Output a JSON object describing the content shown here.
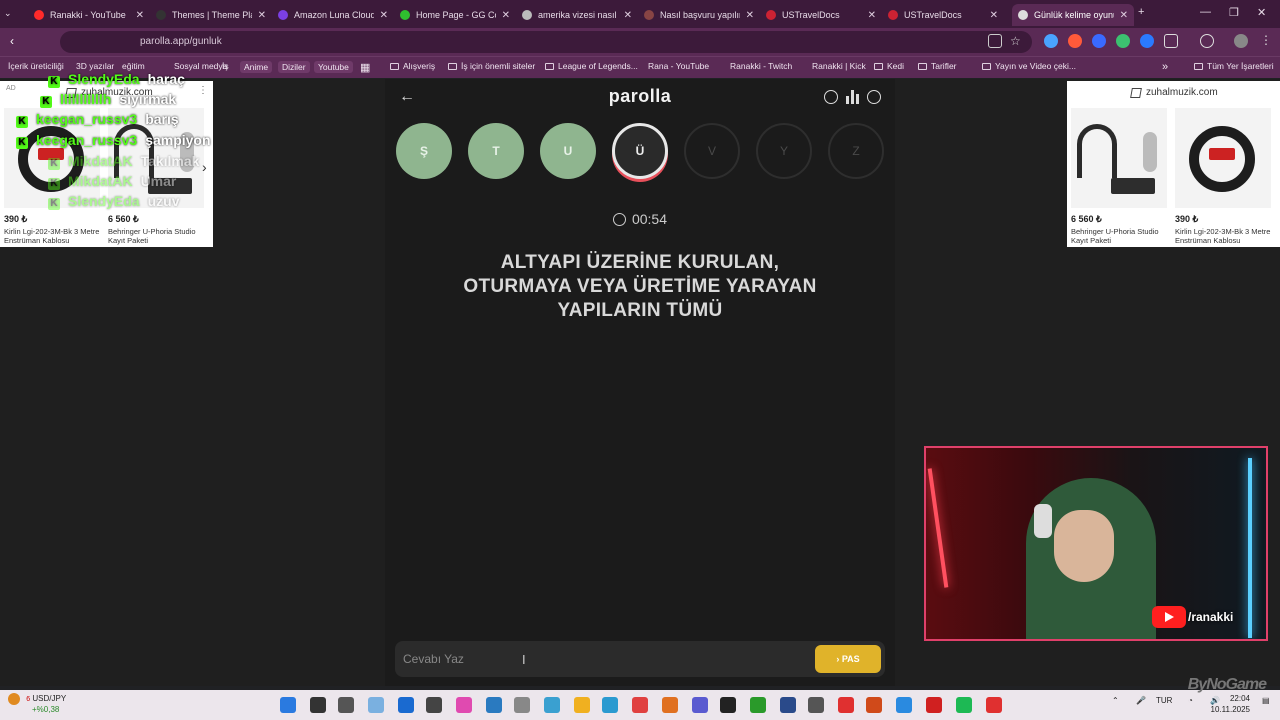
{
  "browser": {
    "tabs": [
      {
        "label": "Ranakki - YouTube",
        "color": "#ff2a2a"
      },
      {
        "label": "Themes | Theme Plaza",
        "color": "#333333"
      },
      {
        "label": "Amazon Luna Cloud",
        "color": "#7b3fe4"
      },
      {
        "label": "Home Page - GG Con",
        "color": "#2fbf2f"
      },
      {
        "label": "amerika vizesi nasıl al",
        "color": "#bbbbbb"
      },
      {
        "label": "Nasıl başvuru yapılır",
        "color": "#884444"
      },
      {
        "label": "USTravelDocs",
        "color": "#cc2233"
      },
      {
        "label": "USTravelDocs",
        "color": "#cc2233"
      },
      {
        "label": "Günlük kelime oyunu",
        "color": "#dddddd"
      }
    ],
    "new_tab": "+",
    "url": "parolla.app/gunluk",
    "bookmarks": [
      {
        "label": "İçerik üreticiliği",
        "folder": false,
        "chip": false
      },
      {
        "label": "3D yazılar",
        "folder": false,
        "chip": false
      },
      {
        "label": "eğitim",
        "folder": false,
        "chip": false
      },
      {
        "label": "Sosyal medya",
        "folder": false,
        "chip": false
      },
      {
        "label": "İş",
        "folder": false,
        "chip": false
      },
      {
        "label": "Anime",
        "folder": false,
        "chip": true
      },
      {
        "label": "Diziler",
        "folder": false,
        "chip": true
      },
      {
        "label": "Youtube",
        "folder": false,
        "chip": true
      },
      {
        "label": "Alışveriş",
        "folder": true,
        "chip": false
      },
      {
        "label": "İş için önemli siteler",
        "folder": true,
        "chip": false
      },
      {
        "label": "League of Legends...",
        "folder": true,
        "chip": false
      },
      {
        "label": "Rana - YouTube",
        "folder": false,
        "chip": false
      },
      {
        "label": "Ranakki - Twitch",
        "folder": false,
        "chip": false
      },
      {
        "label": "Ranakki | Kick",
        "folder": false,
        "chip": false
      },
      {
        "label": "Kedi",
        "folder": true,
        "chip": false
      },
      {
        "label": "Tarifler",
        "folder": true,
        "chip": false
      },
      {
        "label": "Yayın ve Video çeki...",
        "folder": true,
        "chip": false
      },
      {
        "label": "Tüm Yer İşaretleri",
        "folder": true,
        "chip": false
      }
    ]
  },
  "ads": {
    "tag": "AD",
    "left": {
      "source": "zuhalmuzik.com",
      "products": [
        {
          "price": "390 ₺",
          "name": "Kirlin Lgi-202-3M-Bk 3 Metre Enstrüman Kablosu"
        },
        {
          "price": "6 560 ₺",
          "name": "Behringer U-Phoria Studio Kayıt Paketi"
        }
      ]
    },
    "right": {
      "source": "zuhalmuzik.com",
      "products": [
        {
          "price": "6 560 ₺",
          "name": "Behringer U-Phoria Studio Kayıt Paketi"
        },
        {
          "price": "390 ₺",
          "name": "Kirlin Lgi-202-3M-Bk 3 Metre Enstrüman Kablosu"
        }
      ]
    }
  },
  "game": {
    "logo": "parolla",
    "letters": [
      {
        "char": "Ş",
        "state": "done"
      },
      {
        "char": "T",
        "state": "done"
      },
      {
        "char": "U",
        "state": "done"
      },
      {
        "char": "Ü",
        "state": "current"
      },
      {
        "char": "V",
        "state": "todo"
      },
      {
        "char": "Y",
        "state": "todo"
      },
      {
        "char": "Z",
        "state": "todo"
      }
    ],
    "timer": "00:54",
    "question_lines": [
      "ALTYAPI ÜZERİNE KURULAN,",
      "OTURMAYA VEYA ÜRETİME YARAYAN",
      "YAPILARIN TÜMÜ"
    ],
    "answer_placeholder": "Cevabı Yaz",
    "pass_label": "PAS",
    "colors": {
      "done": "#8fb58f",
      "current_ring": "#e8505b",
      "pass": "#e0b32a"
    }
  },
  "chat": [
    {
      "user": "SlendyEda",
      "msg": "haraç",
      "fade": false
    },
    {
      "user": "lllllllllllh",
      "msg": "sıyırmak",
      "fade": false
    },
    {
      "user": "keegan_russv3",
      "msg": "barış",
      "fade": false
    },
    {
      "user": "keegan_russv3",
      "msg": "şampiyon",
      "fade": false
    },
    {
      "user": "MikdatAK",
      "msg": "Takılmak",
      "fade": true
    },
    {
      "user": "MikdatAK",
      "msg": "Umar",
      "fade": true
    },
    {
      "user": "SlendyEda",
      "msg": "uzuv",
      "fade": true
    }
  ],
  "webcam": {
    "channel": "/ranakki"
  },
  "taskbar": {
    "ticker_label": "USD/JPY",
    "ticker_value": "+%0,38",
    "badge": "6",
    "lang": "TUR",
    "time": "22:04",
    "date": "10.11.2025"
  },
  "watermark": "ByNoGame"
}
